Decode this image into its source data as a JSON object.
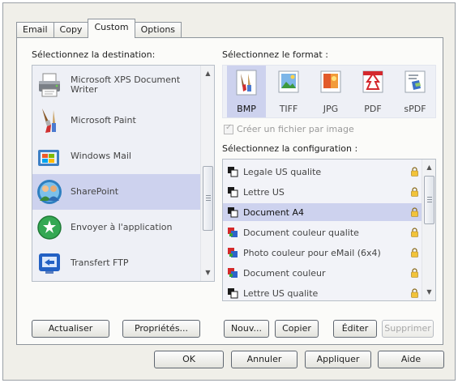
{
  "tabs": [
    {
      "label": "Email",
      "active": false
    },
    {
      "label": "Copy",
      "active": false
    },
    {
      "label": "Custom",
      "active": true
    },
    {
      "label": "Options",
      "active": false
    }
  ],
  "destination": {
    "label": "Sélectionnez la destination:",
    "items": [
      {
        "label": "Microsoft XPS Document Writer",
        "icon": "printer-icon",
        "selected": false
      },
      {
        "label": "Microsoft Paint",
        "icon": "paint-brush-icon",
        "selected": false
      },
      {
        "label": "Windows Mail",
        "icon": "windows-mail-icon",
        "selected": false
      },
      {
        "label": "SharePoint",
        "icon": "sharepoint-icon",
        "selected": true
      },
      {
        "label": "Envoyer à l'application",
        "icon": "send-to-application-icon",
        "selected": false
      },
      {
        "label": "Transfert FTP",
        "icon": "ftp-transfer-icon",
        "selected": false
      }
    ]
  },
  "format": {
    "label": "Sélectionnez le format :",
    "items": [
      {
        "label": "BMP",
        "icon": "bmp-file-icon",
        "selected": true
      },
      {
        "label": "TIFF",
        "icon": "tiff-file-icon",
        "selected": false
      },
      {
        "label": "JPG",
        "icon": "jpg-file-icon",
        "selected": false
      },
      {
        "label": "PDF",
        "icon": "pdf-file-icon",
        "selected": false
      },
      {
        "label": "sPDF",
        "icon": "spdf-file-icon",
        "selected": false
      }
    ],
    "checkbox_label": "Créer un fichier par image",
    "checkbox_checked": true,
    "checkbox_enabled": false
  },
  "configuration": {
    "label": "Sélectionnez la configuration :",
    "items": [
      {
        "label": "Legale US qualite",
        "icon": "black-white-config-icon",
        "selected": false
      },
      {
        "label": "Lettre US",
        "icon": "black-white-config-icon",
        "selected": false
      },
      {
        "label": "Document A4",
        "icon": "black-white-config-icon",
        "selected": true
      },
      {
        "label": "Document couleur qualite",
        "icon": "color-config-icon",
        "selected": false
      },
      {
        "label": "Photo couleur pour eMail (6x4)",
        "icon": "color-config-icon",
        "selected": false
      },
      {
        "label": "Document couleur",
        "icon": "color-config-icon",
        "selected": false
      },
      {
        "label": "Lettre US qualite",
        "icon": "black-white-config-icon",
        "selected": false
      }
    ]
  },
  "buttons": {
    "refresh": "Actualiser",
    "properties": "Propriétés...",
    "new": "Nouv...",
    "copy": "Copier",
    "edit": "Éditer",
    "delete": "Supprimer",
    "ok": "OK",
    "cancel": "Annuler",
    "apply": "Appliquer",
    "help": "Aide"
  },
  "colors": {
    "selection": "#cdd2ee",
    "list_background": "#eef0f6",
    "dialog_background": "#f0efe9"
  }
}
